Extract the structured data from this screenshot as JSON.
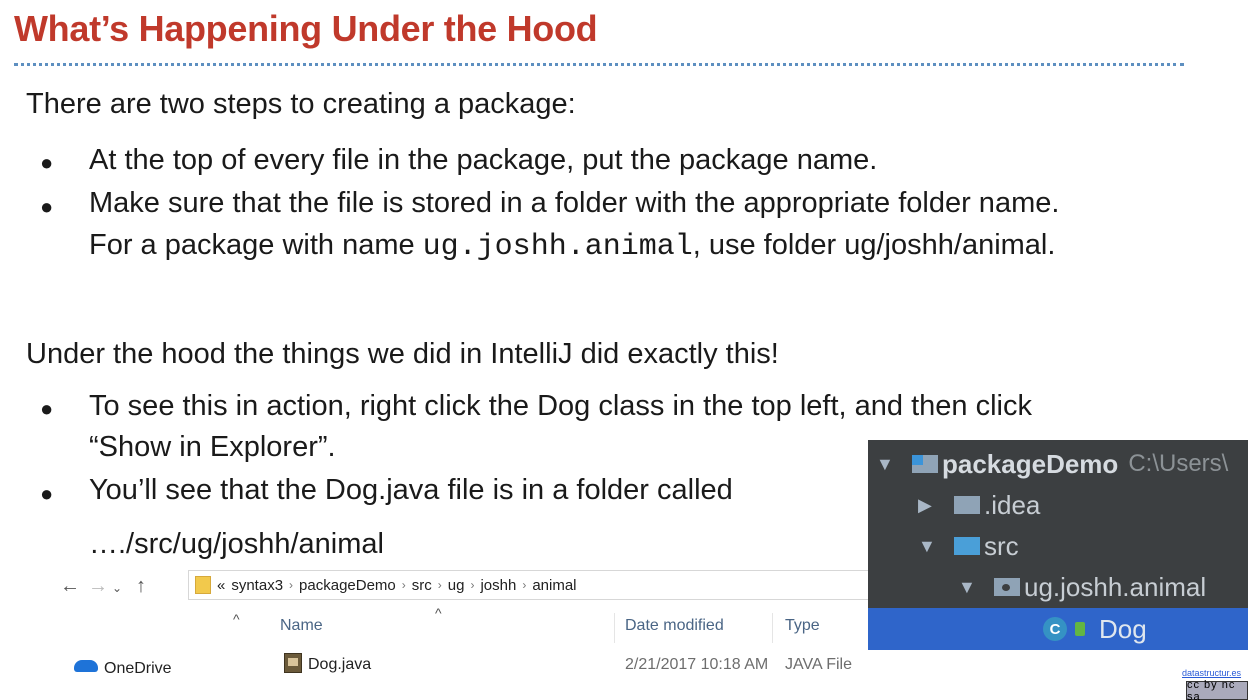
{
  "slide": {
    "title": "What’s Happening Under the Hood",
    "intro": "There are two steps to creating a package:",
    "bullets1": [
      "At the top of every file in the package, put the package name.",
      "Make sure that the file is stored in a folder with the appropriate folder name."
    ],
    "bullet2_cont_pre": "For a package with name ",
    "bullet2_cont_code": "ug.joshh.animal",
    "bullet2_cont_post": ", use folder ug/joshh/animal.",
    "under_hood": "Under the hood the things we did in IntelliJ did exactly this!",
    "bullets2": [
      "To see this in action, right click the Dog class in the top left, and then click",
      "“Show in Explorer”.",
      "You’ll see that the Dog.java file is in a folder called",
      "…./src/ug/joshh/animal"
    ],
    "bullet_glyph": "●"
  },
  "explorer": {
    "breadcrumbs": [
      "«",
      "syntax3",
      "packageDemo",
      "src",
      "ug",
      "joshh",
      "animal"
    ],
    "sep": "›",
    "columns": {
      "name": "Name",
      "date": "Date modified",
      "type": "Type"
    },
    "nav_pane": "OneDrive",
    "file": {
      "name": "Dog.java",
      "date": "2/21/2017 10:18 AM",
      "type": "JAVA File"
    }
  },
  "intellij": {
    "project": "packageDemo",
    "project_path": "C:\\Users\\",
    "items": [
      ".idea",
      "src",
      "ug.joshh.animal"
    ],
    "selected_class": "Dog",
    "class_letter": "C"
  },
  "footer": {
    "link": "datastructur.es",
    "license": "cc by nc sa"
  }
}
